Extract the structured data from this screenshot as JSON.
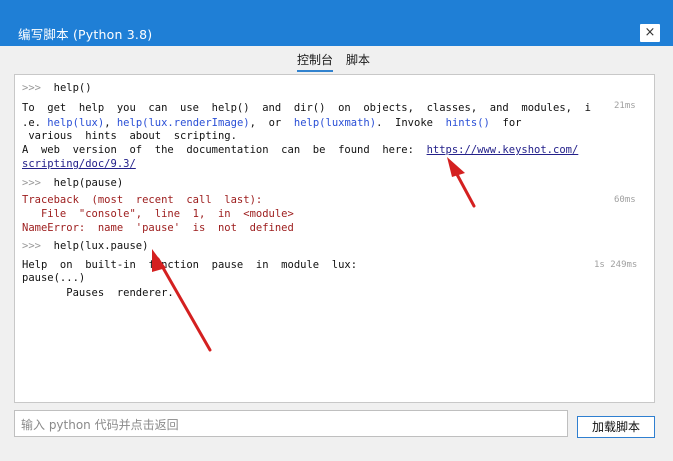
{
  "window": {
    "title": "编写脚本 (Python 3.8)",
    "close_glyph": "×"
  },
  "tabs": [
    {
      "label": "控制台"
    },
    {
      "label": "脚本"
    }
  ],
  "console": {
    "prompt": ">>>",
    "entries": [
      {
        "command": "help()",
        "timing": "21ms",
        "line1": "To  get  help  you  can  use  help()  and  dir()  on  objects,  classes,  and  modules,  i",
        "line2_parts": [
          ".e. ",
          "help(lux)",
          ", ",
          "help(lux.renderImage)",
          ",  or  ",
          "help(luxmath)",
          ".  Invoke  ",
          "hints()",
          "  for"
        ],
        "line3": " various  hints  about  scripting.",
        "line4_prefix": "A  web  version  of  the  documentation  can  be  found  here:  ",
        "line4_link": "https://www.keyshot.com/",
        "line5_link": "scripting/doc/9.3/"
      },
      {
        "command": "help(pause)",
        "timing": "60ms",
        "error_lines": [
          "Traceback  (most  recent  call  last):",
          "   File  \"console\",  line  1,  in  <module>",
          "NameError:  name  'pause'  is  not  defined"
        ]
      },
      {
        "command": "help(lux.pause)",
        "timing": "1s 249ms",
        "output_lines": [
          "Help  on  built-in  function  pause  in  module  lux:",
          "pause(...)",
          "       Pauses  renderer."
        ]
      }
    ]
  },
  "input": {
    "placeholder": "输入 python 代码并点击返回"
  },
  "buttons": {
    "load_script": "加载脚本"
  },
  "colors": {
    "titlebar": "#1f7fd6",
    "annotation_arrow": "#d42020",
    "keyword_blue": "#2a4fd6",
    "error_red": "#9c1b1b"
  },
  "icons": [
    "close-icon"
  ]
}
